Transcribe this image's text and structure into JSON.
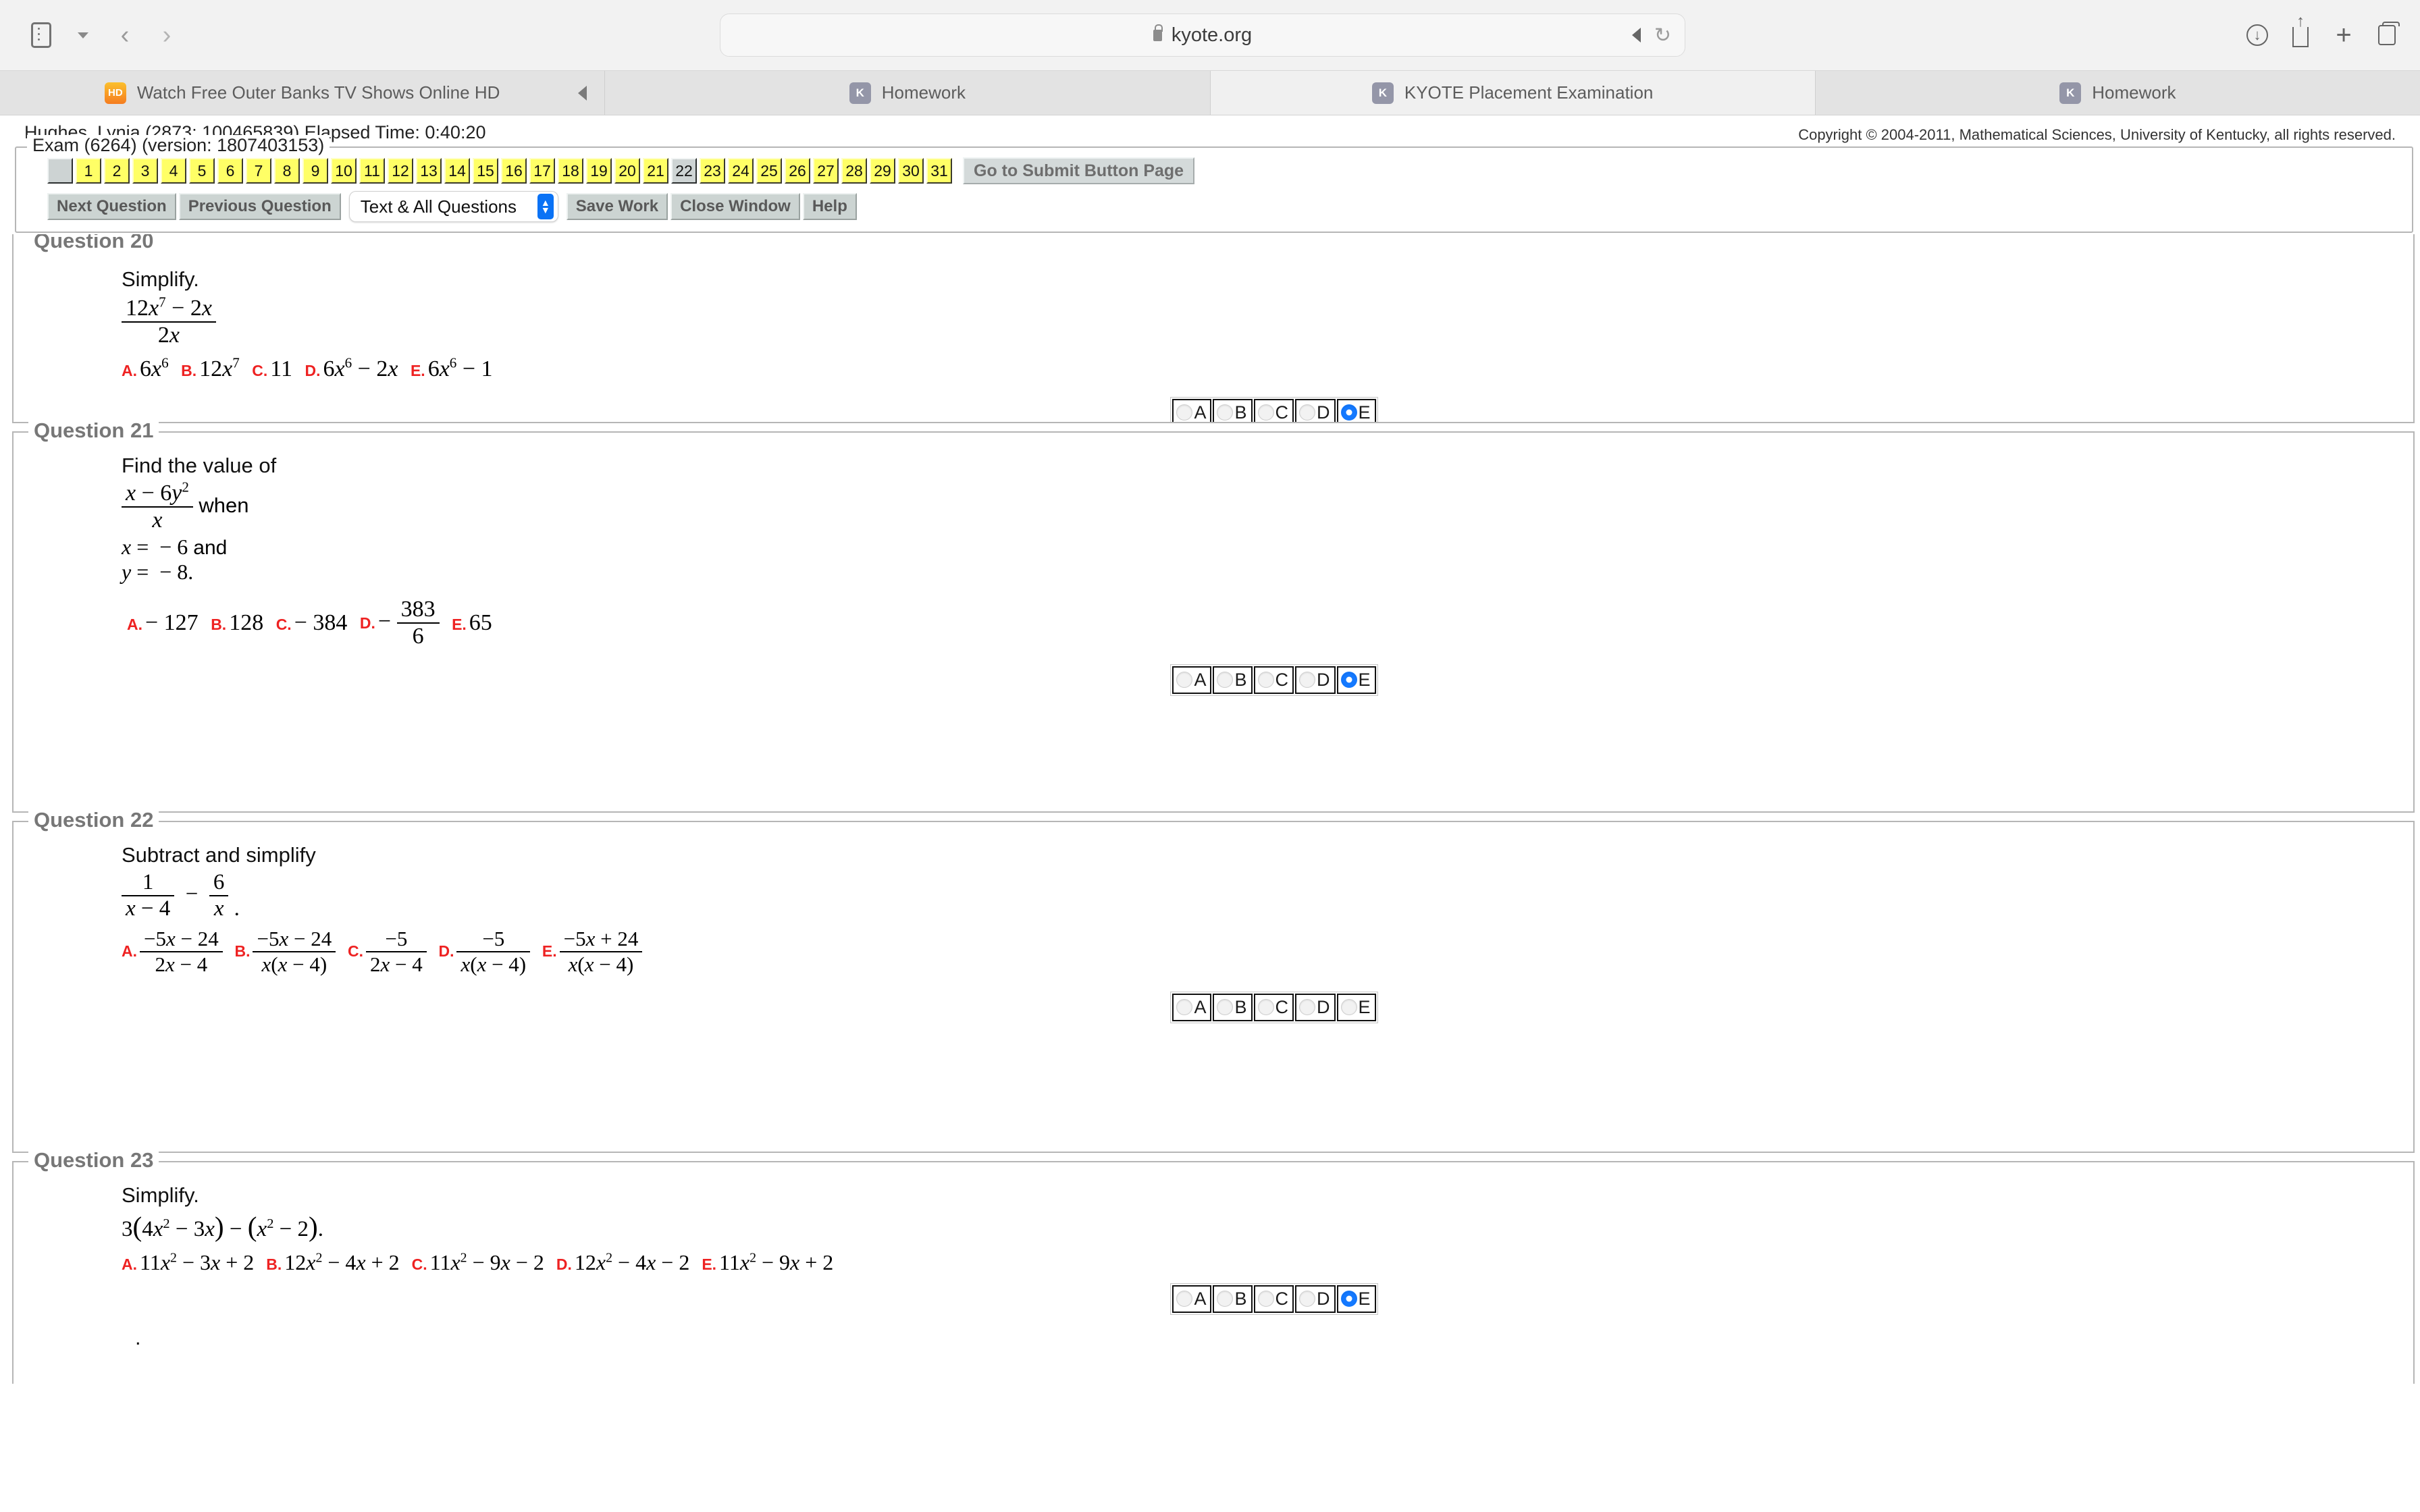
{
  "browser": {
    "url": "kyote.org",
    "icons": {
      "sidebar": "sidebar-icon",
      "chevron": "chevron-down-icon",
      "back": "back-arrow-icon",
      "forward": "forward-arrow-icon",
      "lock": "lock-icon",
      "mute": "speaker-mute-icon",
      "reload": "reload-icon",
      "download": "download-icon",
      "share": "share-icon",
      "new_tab": "plus-icon",
      "tab_overview": "tabs-icon"
    },
    "tabs": [
      {
        "title": "Watch Free Outer Banks TV Shows Online HD",
        "favicon": "HD",
        "favicon_kind": "hd",
        "active": false,
        "muted": true
      },
      {
        "title": "Homework",
        "favicon": "K",
        "favicon_kind": "k",
        "active": false,
        "muted": false
      },
      {
        "title": "KYOTE Placement Examination",
        "favicon": "K",
        "favicon_kind": "k",
        "active": true,
        "muted": false
      },
      {
        "title": "Homework",
        "favicon": "K",
        "favicon_kind": "k",
        "active": false,
        "muted": false
      }
    ]
  },
  "exam": {
    "student_line": "Hughes, Lynia (2873; 100465839) Elapsed Time: 0:40:20",
    "copyright": "Copyright © 2004-2011, Mathematical Sciences, University of Kentucky, all rights reserved.",
    "legend": "Exam (6264) (version: 1807403153)",
    "nav_buttons": [
      "",
      "1",
      "2",
      "3",
      "4",
      "5",
      "6",
      "7",
      "8",
      "9",
      "10",
      "11",
      "12",
      "13",
      "14",
      "15",
      "16",
      "17",
      "18",
      "19",
      "20",
      "21",
      "22",
      "23",
      "24",
      "25",
      "26",
      "27",
      "28",
      "29",
      "30",
      "31"
    ],
    "current_question": "22",
    "submit_label": "Go to Submit Button Page",
    "toolbar": {
      "next": "Next Question",
      "previous": "Previous Question",
      "view_mode": "Text & All Questions",
      "save": "Save Work",
      "close": "Close Window",
      "help": "Help"
    },
    "answer_letters": [
      "A",
      "B",
      "C",
      "D",
      "E"
    ]
  },
  "questions": [
    {
      "legend": "Question 20",
      "prompt": "Simplify.",
      "selected": "E",
      "trailing": ""
    },
    {
      "legend": "Question 21",
      "prompt": "Find the value of",
      "when_word": "when",
      "given_x": "x = − 6 and",
      "given_y": "y = − 8.",
      "selected": "E",
      "trailing": ""
    },
    {
      "legend": "Question 22",
      "prompt": "Subtract and simplify",
      "selected": "",
      "trailing": ""
    },
    {
      "legend": "Question 23",
      "prompt": "Simplify.",
      "selected": "E",
      "trailing": "."
    }
  ],
  "q20": {
    "expr_num": "12x7 − 2x",
    "expr_den": "2x",
    "options": [
      {
        "label": "A.",
        "text": "6x6"
      },
      {
        "label": "B.",
        "text": "12x7"
      },
      {
        "label": "C.",
        "text": "11"
      },
      {
        "label": "D.",
        "text": "6x6 − 2x"
      },
      {
        "label": "E.",
        "text": "6x6 − 1"
      }
    ]
  },
  "q21": {
    "expr_num": "x − 6y2",
    "expr_den": "x",
    "options": [
      {
        "label": "A.",
        "text": "− 127"
      },
      {
        "label": "B.",
        "text": "128"
      },
      {
        "label": "C.",
        "text": "− 384"
      },
      {
        "label": "D.",
        "text": "− 383/6"
      },
      {
        "label": "E.",
        "text": "65"
      }
    ]
  },
  "q22": {
    "expr": "1/(x − 4) − 6/x .",
    "options": [
      {
        "label": "A.",
        "num": "− 5x − 24",
        "den": "2x − 4"
      },
      {
        "label": "B.",
        "num": "− 5x − 24",
        "den": "x(x − 4)"
      },
      {
        "label": "C.",
        "num": "− 5",
        "den": "2x − 4"
      },
      {
        "label": "D.",
        "num": "− 5",
        "den": "x(x − 4)"
      },
      {
        "label": "E.",
        "num": "− 5x + 24",
        "den": "x(x − 4)"
      }
    ]
  },
  "q23": {
    "expr": "3(4x2 − 3x) − (x2 − 2).",
    "options": [
      {
        "label": "A.",
        "text": "11x2 − 3x + 2"
      },
      {
        "label": "B.",
        "text": "12x2 − 4x + 2"
      },
      {
        "label": "C.",
        "text": "11x2 − 9x − 2"
      },
      {
        "label": "D.",
        "text": "12x2 − 4x − 2"
      },
      {
        "label": "E.",
        "text": "11x2 − 9x + 2"
      }
    ]
  }
}
